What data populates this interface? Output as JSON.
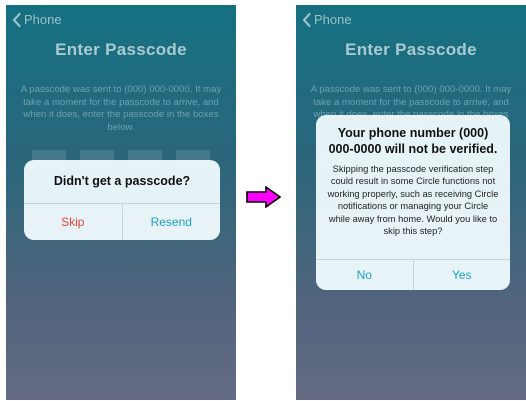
{
  "colors": {
    "arrow_fill": "#ff00ff",
    "destructive": "#e8453c",
    "action": "#1aa2c4"
  },
  "screen_before": {
    "nav": {
      "back_label": "Phone",
      "icon": "chevron-left-icon"
    },
    "title": "Enter Passcode",
    "info_text": "A passcode was sent to (000) 000-0000. It may take a moment for the passcode to arrive, and when it does, enter the passcode in the boxes below.",
    "alert": {
      "title": "Didn't get a passcode?",
      "buttons": {
        "skip": "Skip",
        "resend": "Resend"
      }
    }
  },
  "screen_after": {
    "nav": {
      "back_label": "Phone",
      "icon": "chevron-left-icon"
    },
    "title": "Enter Passcode",
    "info_text": "A passcode was sent to (000) 000-0000. It may take a moment for the passcode to arrive, and when it does, enter the passcode in the boxes below.",
    "alert": {
      "title": "Your phone number (000) 000-0000 will not be verified.",
      "message": "Skipping the passcode verification step could result in some Circle functions not working properly, such as receiving Circle notifications or managing your Circle while away from home. Would you like to skip this step?",
      "buttons": {
        "no": "No",
        "yes": "Yes"
      }
    }
  },
  "transition_arrow": {
    "icon": "arrow-right-icon"
  }
}
